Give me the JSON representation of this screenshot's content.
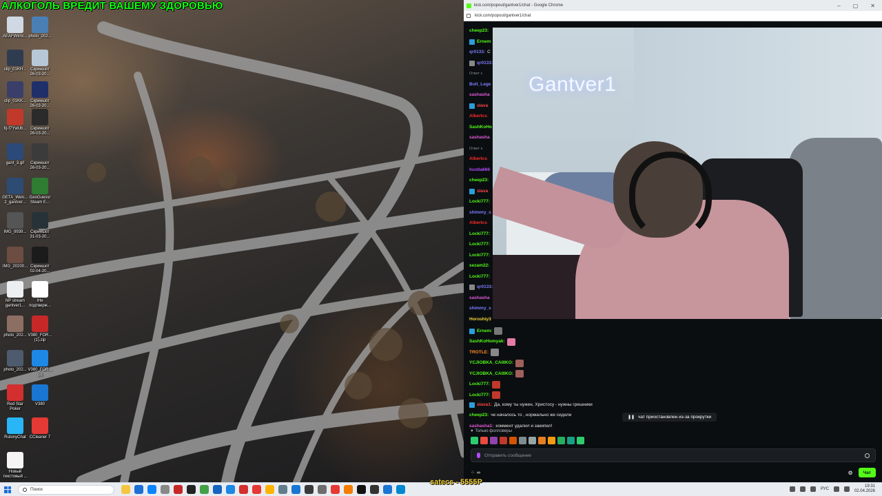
{
  "desktop": {
    "banner": "АЛКОГОЛЬ ВРЕДИТ ВАШЕМУ ЗДОРОВЬЮ",
    "icons": [
      {
        "label": "AEAFWtmc...",
        "color": "#cfd8e3"
      },
      {
        "label": "photo_202...",
        "color": "#4a7fb5"
      },
      {
        "label": "clip_01KH...",
        "color": "#2f3c4f"
      },
      {
        "label": "Скриншот\n26-03-20...",
        "color": "#b7c7d8"
      },
      {
        "label": "clip_01KK...",
        "color": "#3a3f6a"
      },
      {
        "label": "Скриншот\n26-03-20...",
        "color": "#1f2f6a"
      },
      {
        "label": "fq-f7YwUb...",
        "color": "#c0392b"
      },
      {
        "label": "Скриншот\n26-03-20...",
        "color": "#2b2b2b"
      },
      {
        "label": "gant_3.gif",
        "color": "#2b4a7a"
      },
      {
        "label": "Скриншот\n26-03-20...",
        "color": "#3b3b3b"
      },
      {
        "label": "GETA_Welc...\n2_gantver...",
        "color": "#2d4b73"
      },
      {
        "label": "GeoGuessr\nSteam E...",
        "color": "#2e7d32"
      },
      {
        "label": "IMG_9939...",
        "color": "#555555"
      },
      {
        "label": "Скриншот\n31-03-20...",
        "color": "#263238"
      },
      {
        "label": "IMG_20200...",
        "color": "#6d4c41"
      },
      {
        "label": "Скриншот\n02-04-20...",
        "color": "#1b1b1b"
      },
      {
        "label": "NP stream\ngantver1...",
        "color": "#eceff1"
      },
      {
        "label": "!Не\nподтверж...",
        "color": "#ffffff"
      },
      {
        "label": "photo_202...",
        "color": "#8d6e63"
      },
      {
        "label": "V380_FOR...\n(1).zip",
        "color": "#c62828"
      },
      {
        "label": "photo_202...",
        "color": "#4e5b6e"
      },
      {
        "label": "V380_FOR...\n(1)",
        "color": "#1e88e5"
      },
      {
        "label": "Red Star\nPoker",
        "color": "#d32f2f"
      },
      {
        "label": "V380",
        "color": "#1976d2"
      },
      {
        "label": "RutonyChat",
        "color": "#29b6f6"
      },
      {
        "label": "CCleaner 7",
        "color": "#e53935"
      },
      {
        "label": "Новый\nтекстовый ...",
        "color": "#f5f5f5"
      }
    ]
  },
  "browser": {
    "title": "kick.com/popout/gantver1/chat - Google Chrome",
    "url": "kick.com/popout/gantver1/chat",
    "neon_sign": "Gantver1",
    "messages": [
      {
        "user": "cheep23:",
        "color": "#53fc18",
        "text": "",
        "badge": ""
      },
      {
        "user": "Ernem",
        "color": "#53fc18",
        "text": "",
        "badge": "#2b9ed8"
      },
      {
        "user": "qr0133:",
        "color": "#7d7dff",
        "text": "С",
        "badge": ""
      },
      {
        "user": "qr0133:",
        "color": "#7d7dff",
        "text": "",
        "badge": "#888"
      },
      {
        "user": "Ответ с",
        "color": "#8a8f93",
        "text": "",
        "badge": "",
        "reply": true
      },
      {
        "user": "Bolt_Lege",
        "color": "#7d7dff",
        "text": "",
        "badge": ""
      },
      {
        "user": "sashasha",
        "color": "#e05bd8",
        "text": "",
        "badge": ""
      },
      {
        "user": "slava",
        "color": "#ff4444",
        "text": "",
        "badge": "#2b9ed8"
      },
      {
        "user": "Albertcs",
        "color": "#ff2a2a",
        "text": "",
        "badge": ""
      },
      {
        "user": "SashKoHo",
        "color": "#53fc18",
        "text": "",
        "badge": ""
      },
      {
        "user": "sashasha",
        "color": "#e05bd8",
        "text": "",
        "badge": ""
      },
      {
        "user": "Ответ s",
        "color": "#8a8f93",
        "text": "",
        "badge": "",
        "reply": true
      },
      {
        "user": "Albertcs",
        "color": "#ff2a2a",
        "text": "",
        "badge": ""
      },
      {
        "user": "hustla666",
        "color": "#b14bff",
        "text": "",
        "badge": ""
      },
      {
        "user": "cheep23:",
        "color": "#53fc18",
        "text": "",
        "badge": ""
      },
      {
        "user": "slava",
        "color": "#ff4444",
        "text": "",
        "badge": "#2b9ed8"
      },
      {
        "user": "Locki777:",
        "color": "#53fc18",
        "text": "",
        "badge": ""
      },
      {
        "user": "shimmy_s",
        "color": "#7d7dff",
        "text": "",
        "badge": ""
      },
      {
        "user": "Albertcs",
        "color": "#ff2a2a",
        "text": "",
        "badge": ""
      },
      {
        "user": "Locki777:",
        "color": "#53fc18",
        "text": "",
        "badge": ""
      },
      {
        "user": "Locki777:",
        "color": "#53fc18",
        "text": "",
        "badge": ""
      },
      {
        "user": "Locki777:",
        "color": "#53fc18",
        "text": "",
        "badge": ""
      },
      {
        "user": "sezam22:",
        "color": "#53fc18",
        "text": "",
        "badge": ""
      },
      {
        "user": "Locki777:",
        "color": "#53fc18",
        "text": "",
        "badge": ""
      },
      {
        "user": "qr0133:",
        "color": "#7d7dff",
        "text": "",
        "badge": "#888"
      },
      {
        "user": "sashasha",
        "color": "#e05bd8",
        "text": "",
        "badge": ""
      },
      {
        "user": "shimmy_s",
        "color": "#7d7dff",
        "text": "",
        "badge": ""
      },
      {
        "user": "Horoshiy3",
        "color": "#f4d33a",
        "text": "",
        "badge": ""
      },
      {
        "user": "Ernem:",
        "color": "#53fc18",
        "text": "",
        "badge": "#2b9ed8",
        "emote": "#777"
      },
      {
        "user": "SashKoHomyak:",
        "color": "#53fc18",
        "text": "",
        "badge": "",
        "emote": "#e57aa8"
      },
      {
        "user": "TROTLE:",
        "color": "#ff8c2a",
        "text": "",
        "badge": "",
        "emote": "#888"
      },
      {
        "user": "YCJIOBKA_CAIIIKO:",
        "color": "#53fc18",
        "text": "",
        "badge": "",
        "emote": "#a0605a"
      },
      {
        "user": "YCJIOBKA_CAIIIKO:",
        "color": "#53fc18",
        "text": "",
        "badge": "",
        "emote": "#a0605a"
      },
      {
        "user": "Locki777:",
        "color": "#53fc18",
        "text": "",
        "badge": "",
        "emote": "#c0392b"
      },
      {
        "user": "Locki777:",
        "color": "#53fc18",
        "text": "",
        "badge": "",
        "emote": "#c0392b"
      },
      {
        "user": "slava1:",
        "color": "#ff4444",
        "text": "Да, кому ты нужен, Христосу - нужны грешники",
        "badge": "#2b9ed8"
      },
      {
        "user": "cheep23:",
        "color": "#53fc18",
        "text": "че началось то , нормально же сидели",
        "badge": ""
      },
      {
        "user": "sashasha1:",
        "color": "#e05bd8",
        "text": "коммент удалил и закипел!",
        "badge": ""
      }
    ],
    "paused_text": "чат приостановлен из-за прокрутки",
    "followers_only": "Только фолловеры",
    "input_placeholder": "Отправить сообщение",
    "points": "∞",
    "send_label": "Чат",
    "emote_colors": [
      "#2ecc71",
      "#e74c3c",
      "#8e44ad",
      "#c0392b",
      "#d35400",
      "#7f8c8d",
      "#95a5a6",
      "#e67e22",
      "#f39c12",
      "#27ae60",
      "#16a085",
      "#2ecc71"
    ]
  },
  "taskbar": {
    "search_placeholder": "Поиск",
    "overlay": "satecs - 5555P",
    "tray_lang": "РУС",
    "time": "19:31",
    "date": "02.04.2026",
    "apps": [
      "#f5c542",
      "#1d6fd6",
      "#0a84ff",
      "#888",
      "#c62828",
      "#222",
      "#43a047",
      "#1565c0",
      "#1e88e5",
      "#d32f2f",
      "#e53935",
      "#ffb300",
      "#607d8b",
      "#1976d2",
      "#3a3a3a",
      "#6d6d6d",
      "#e53935",
      "#f57c00",
      "#111",
      "#333",
      "#1976d2",
      "#0288d1"
    ]
  }
}
